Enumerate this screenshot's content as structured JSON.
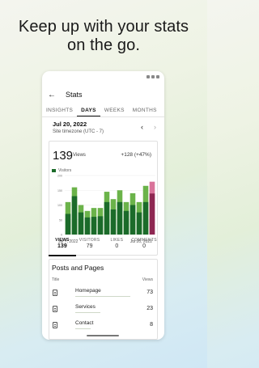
{
  "headline": {
    "line1": "Keep up with your stats",
    "line2": "on the go."
  },
  "app": {
    "title": "Stats"
  },
  "tabs": [
    {
      "label": "INSIGHTS",
      "active": false
    },
    {
      "label": "DAYS",
      "active": true
    },
    {
      "label": "WEEKS",
      "active": false
    },
    {
      "label": "MONTHS",
      "active": false
    }
  ],
  "date": {
    "value": "Jul 20, 2022",
    "timezone": "Site timezone (UTC - 7)"
  },
  "summary": {
    "views": "139",
    "unit": "Views",
    "change": "+128 (+47%)",
    "legend": "Visitors"
  },
  "chart_data": {
    "type": "bar",
    "title": "",
    "xlabel": "",
    "ylabel": "",
    "ylim": [
      0,
      200
    ],
    "y_ticks": [
      "200",
      "150",
      "100",
      "50",
      "0"
    ],
    "x_start_label": "Jul 7, 2022",
    "x_end_label": "Jul 20, 2022",
    "series": [
      {
        "name": "Views",
        "values": [
          110,
          160,
          100,
          80,
          90,
          90,
          145,
          120,
          150,
          110,
          140,
          110,
          165,
          179
        ]
      },
      {
        "name": "Visitors",
        "values": [
          70,
          130,
          75,
          58,
          60,
          62,
          110,
          85,
          110,
          80,
          100,
          75,
          110,
          139
        ]
      }
    ],
    "colors": {
      "views": "#6bb34a",
      "visitors": "#1b6b2a",
      "selected_views": "#d9739a",
      "selected_visitors": "#8e2752"
    },
    "selected_index": 13
  },
  "metrics": [
    {
      "label": "VIEWS",
      "value": "139",
      "active": true
    },
    {
      "label": "VISITORS",
      "value": "79",
      "active": false
    },
    {
      "label": "LIKES",
      "value": "0",
      "active": false
    },
    {
      "label": "COMMENTS",
      "value": "0",
      "active": false
    }
  ],
  "posts": {
    "title": "Posts and Pages",
    "col_title": "Title",
    "col_views": "Views",
    "rows": [
      {
        "label": "Homepage",
        "value": "73",
        "fraction": 1.0
      },
      {
        "label": "Services",
        "value": "23",
        "fraction": 0.45
      },
      {
        "label": "Contact",
        "value": "8",
        "fraction": 0.28
      }
    ]
  }
}
